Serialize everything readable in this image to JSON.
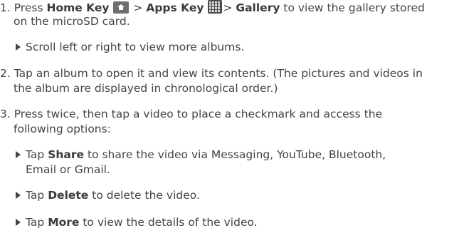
{
  "steps": [
    {
      "number": "1.",
      "line1": {
        "press": "Press",
        "home_key": "Home Key",
        "gt1": ">",
        "apps_key": "Apps Key",
        "gt2": ">",
        "gallery": "Gallery",
        "rest": "to view the gallery stored"
      },
      "line2": "on the microSD card.",
      "bullets": [
        {
          "text": "Scroll left or right to view more albums."
        }
      ]
    },
    {
      "number": "2.",
      "line1": "Tap an album to open it and view its contents. (The pictures and videos in",
      "line2": "the album are displayed in chronological order.)"
    },
    {
      "number": "3.",
      "line1": "Press twice, then tap a video to place a checkmark and access the",
      "line2": "following options:",
      "bullets": [
        {
          "pre": "Tap",
          "bold": "Share",
          "post": "to share the video via Messaging, YouTube, Bluetooth,",
          "cont": "Email or Gmail."
        },
        {
          "pre": "Tap",
          "bold": "Delete",
          "post": "to delete the video."
        },
        {
          "pre": "Tap",
          "bold": "More",
          "post": "to view the details of the video."
        }
      ]
    }
  ],
  "icons": {
    "home": "home-key-icon",
    "apps": "apps-key-icon"
  }
}
